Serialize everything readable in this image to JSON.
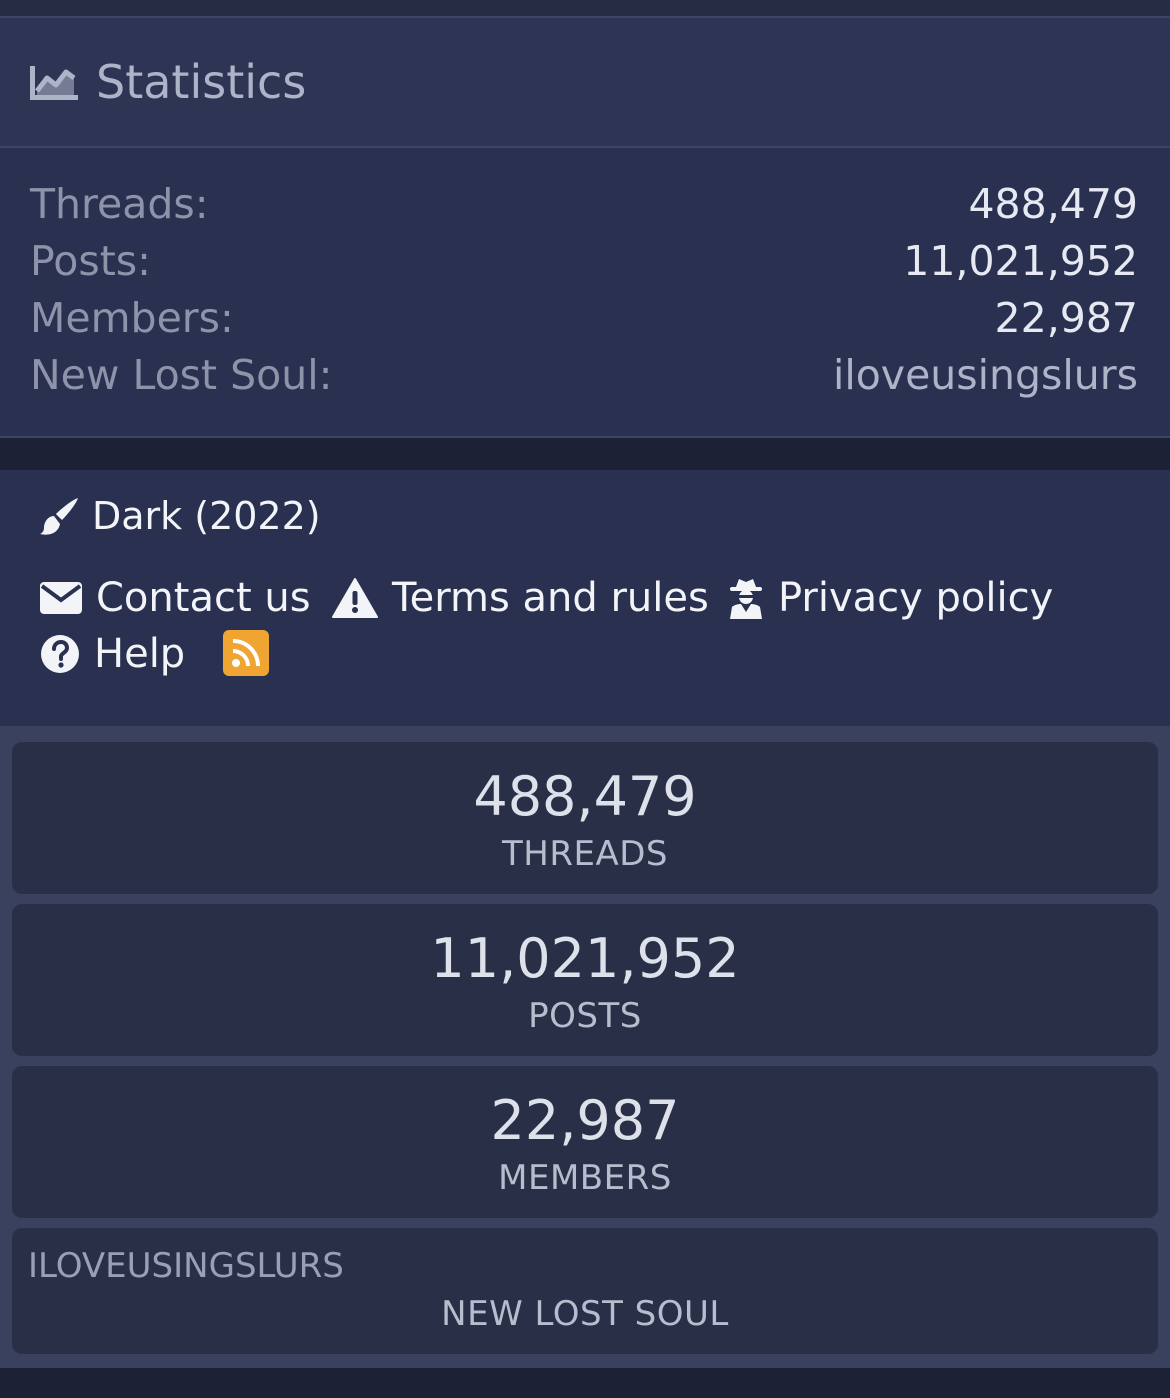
{
  "statistics": {
    "title": "Statistics",
    "title_icon": "chart-area-icon",
    "rows": [
      {
        "label": "Threads:",
        "value": "488,479"
      },
      {
        "label": "Posts:",
        "value": "11,021,952"
      },
      {
        "label": "Members:",
        "value": "22,987"
      },
      {
        "label": "New Lost Soul:",
        "value": "iloveusingslurs"
      }
    ]
  },
  "footer": {
    "style_chooser": {
      "icon": "paint-brush-icon",
      "label": "Dark (2022)"
    },
    "links": [
      {
        "icon": "envelope-icon",
        "label": "Contact us"
      },
      {
        "icon": "warning-icon",
        "label": "Terms and rules"
      },
      {
        "icon": "user-secret-icon",
        "label": "Privacy policy"
      },
      {
        "icon": "question-circle-icon",
        "label": "Help"
      }
    ],
    "rss_icon": "rss-icon",
    "rss_color": "#f0a431"
  },
  "cards": [
    {
      "value": "488,479",
      "label": "THREADS"
    },
    {
      "value": "11,021,952",
      "label": "POSTS"
    },
    {
      "value": "22,987",
      "label": "MEMBERS"
    }
  ],
  "latest_member_card": {
    "username": "ILOVEUSINGSLURS",
    "label": "NEW LOST SOUL"
  }
}
